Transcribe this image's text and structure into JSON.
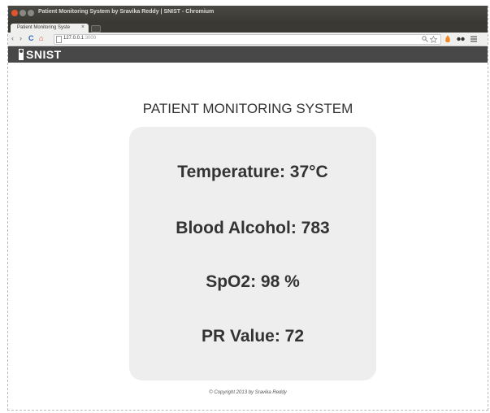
{
  "window": {
    "title": "Patient Monitoring System by Sravika Reddy | SNIST - Chromium"
  },
  "tab": {
    "label": "Patient Monitoring Syste",
    "close_glyph": "×"
  },
  "toolbar": {
    "back_icon": "‹",
    "forward_icon": "›",
    "reload_icon": "C",
    "home_icon": "⌂",
    "url_host": "127.0.0.1",
    "url_port": ":3000",
    "right_icons": [
      "magnifier-icon",
      "star-icon",
      "extension-icon",
      "menu-icon"
    ]
  },
  "site": {
    "logo_text": "SNIST"
  },
  "page": {
    "title": "PATIENT MONITORING SYSTEM",
    "readings": [
      "Temperature: 37°C",
      "Blood Alcohol: 783",
      "SpO2: 98 %",
      "PR Value: 72"
    ],
    "footer": "© Copyright 2013 by Sravika Reddy"
  },
  "colors": {
    "sitebar": "#484848",
    "card": "#eeeeee",
    "titlebar": "#3a3934"
  }
}
